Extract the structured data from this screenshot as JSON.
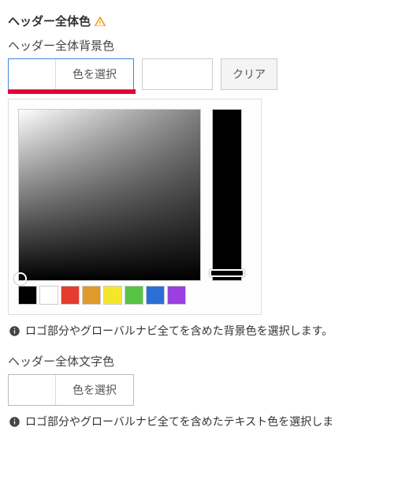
{
  "section": {
    "title": "ヘッダー全体色"
  },
  "bgcolor": {
    "label": "ヘッダー全体背景色",
    "select_button": "色を選択",
    "text_value": "",
    "clear_button": "クリア",
    "help": "ロゴ部分やグローバルナビ全てを含めた背景色を選択します。"
  },
  "picker": {
    "swatches": [
      "#000000",
      "#ffffff",
      "#e63b2e",
      "#e09a2b",
      "#f3e72a",
      "#57c443",
      "#2a6fd6",
      "#9a3fe0"
    ]
  },
  "textcolor": {
    "label": "ヘッダー全体文字色",
    "select_button": "色を選択",
    "help": "ロゴ部分やグローバルナビ全てを含めたテキスト色を選択しま"
  }
}
